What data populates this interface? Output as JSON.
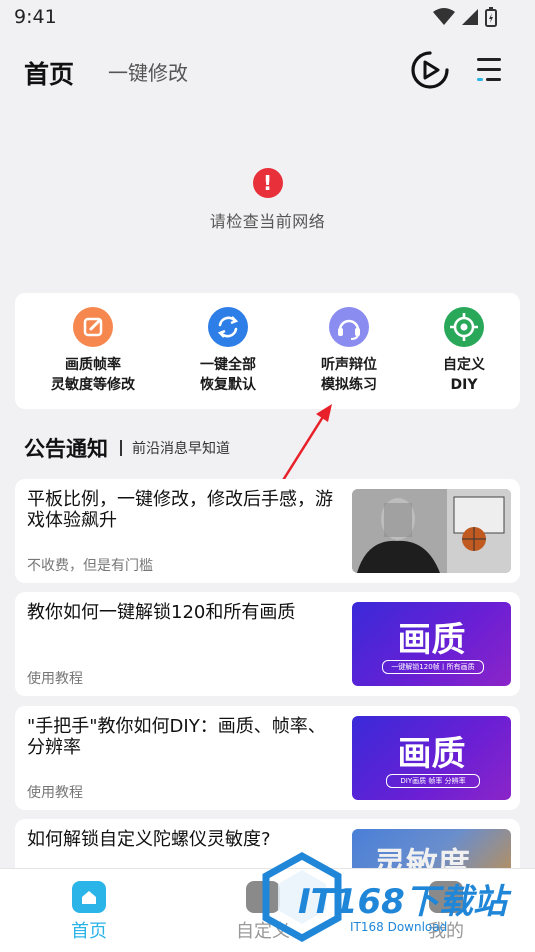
{
  "status": {
    "time": "9:41"
  },
  "header": {
    "title": "首页",
    "subtitle": "一键修改"
  },
  "network": {
    "message": "请检查当前网络"
  },
  "tools": [
    {
      "line1": "画质帧率",
      "line2": "灵敏度等修改",
      "color": "#f5874f",
      "icon": "edit-icon"
    },
    {
      "line1": "一键全部",
      "line2": "恢复默认",
      "color": "#2d7ee6",
      "icon": "refresh-icon"
    },
    {
      "line1": "听声辩位",
      "line2": "模拟练习",
      "color": "#8a8cf0",
      "icon": "headset-icon"
    },
    {
      "line1": "自定义",
      "line2": "DIY",
      "color": "#2aa85a",
      "icon": "target-icon"
    }
  ],
  "announce": {
    "title": "公告通知",
    "subtitle": "前沿消息早知道"
  },
  "news": [
    {
      "title": "平板比例，一键修改，修改后手感，游戏体验飙升",
      "tag": "不收费，但是有门槛",
      "thumb_text": ""
    },
    {
      "title": "教你如何一键解锁120和所有画质",
      "tag": "使用教程",
      "thumb_text": "画质",
      "thumb_sub": "一键解锁120帧丨所有画质"
    },
    {
      "title": "\"手把手\"教你如何DIY：画质、帧率、分辨率",
      "tag": "使用教程",
      "thumb_text": "画质",
      "thumb_sub": "DIY画质  帧率  分辨率"
    },
    {
      "title": "如何解锁自定义陀螺仪灵敏度?",
      "tag": "",
      "thumb_text": "灵敏度"
    }
  ],
  "nav": [
    {
      "label": "首页",
      "active": true
    },
    {
      "label": "自定义",
      "active": false
    },
    {
      "label": "我的",
      "active": false
    }
  ],
  "watermark": {
    "brand": "IT168下载站",
    "sub": "IT168 Download"
  },
  "colors": {
    "accent": "#2ab4e8",
    "error": "#e8303a",
    "thumb_purple": "#5a1fd0"
  }
}
